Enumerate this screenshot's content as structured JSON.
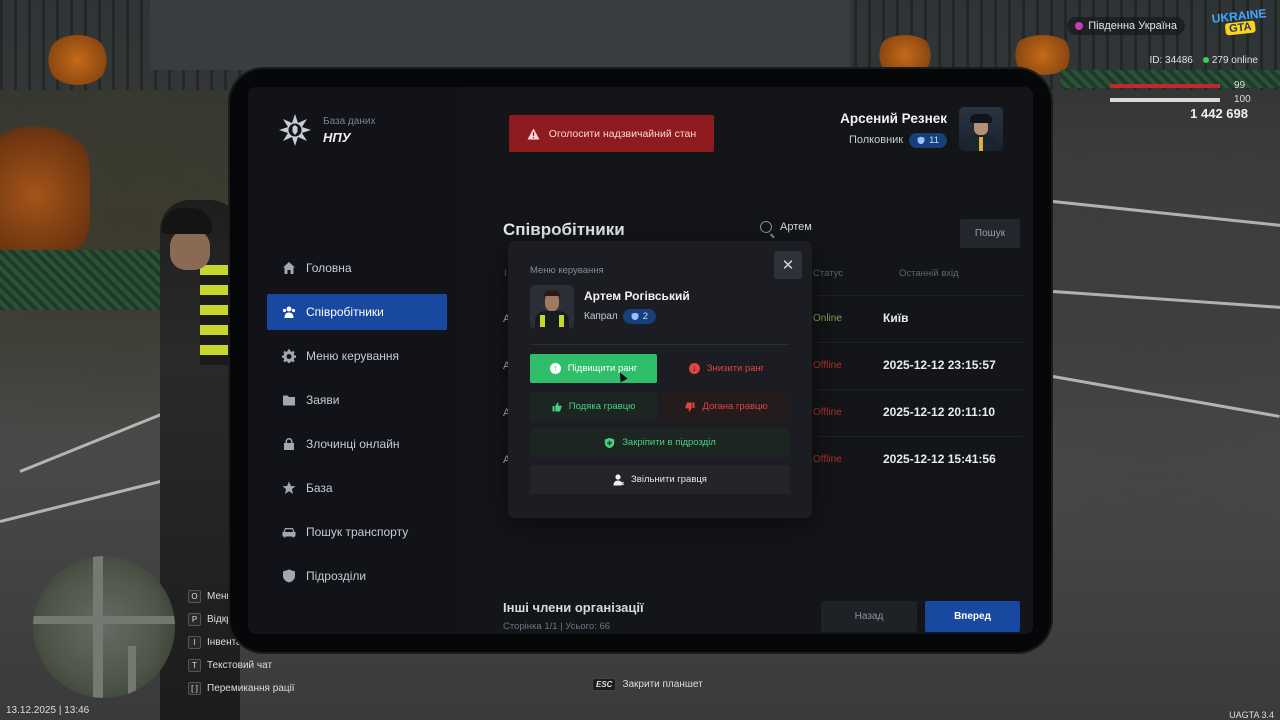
{
  "hud": {
    "region": "Південна Україна",
    "logo_line1": "UKRAINE",
    "logo_line2": "GTA",
    "id_label": "ID: 34486",
    "online_label": "279 online",
    "health": "99",
    "health_fraction": 0.99,
    "armor": "100",
    "armor_fraction": 1.0,
    "money": "1 442 698",
    "date": "13.12.2025 | 13:46",
    "version": "UAGTA 3.4",
    "hints": [
      {
        "key": "O",
        "label": "Меню"
      },
      {
        "key": "P",
        "label": "Відкрити"
      },
      {
        "key": "I",
        "label": "Інвентар"
      },
      {
        "key": "T",
        "label": "Текстовий чат"
      },
      {
        "key": "[ ]",
        "label": "Перемикання рації"
      }
    ],
    "esc_key": "ESC",
    "esc_label": "Закрити планшет"
  },
  "brand": {
    "subtitle": "База даних",
    "name": "НПУ"
  },
  "alert_button": "Оголосити надзвичайний стан",
  "profile": {
    "name": "Арсений Резнек",
    "rank": "Полковник",
    "rank_level": "11"
  },
  "nav": [
    {
      "label": "Головна",
      "icon": "home-icon"
    },
    {
      "label": "Співробітники",
      "icon": "users-icon"
    },
    {
      "label": "Меню керування",
      "icon": "gear-icon"
    },
    {
      "label": "Заяви",
      "icon": "folder-icon"
    },
    {
      "label": "Злочинці онлайн",
      "icon": "lock-icon"
    },
    {
      "label": "База",
      "icon": "star-icon"
    },
    {
      "label": "Пошук транспорту",
      "icon": "car-icon"
    },
    {
      "label": "Підрозділи",
      "icon": "shield-icon"
    }
  ],
  "page": {
    "title": "Співробітники",
    "search_value": "Артем",
    "search_button": "Пошук",
    "columns": {
      "first": "І",
      "status": "Статус",
      "last_login": "Останній вхід"
    },
    "rows": [
      {
        "first": "А",
        "status": "Online",
        "last": "Київ"
      },
      {
        "first": "А",
        "status": "Offline",
        "last": "2025-12-12 23:15:57"
      },
      {
        "first": "А",
        "status": "Offline",
        "last": "2025-12-12 20:11:10"
      },
      {
        "first": "А",
        "status": "Offline",
        "last": "2025-12-12 15:41:56"
      }
    ],
    "footer_title": "Інші члени організації",
    "footer_pages": "Сторінка 1/1 | Усього: 66",
    "back": "Назад",
    "next": "Вперед"
  },
  "modal": {
    "label": "Меню керування",
    "name": "Артем Рогівський",
    "rank": "Капрал",
    "rank_level": "2",
    "promote": "Підвищити ранг",
    "demote": "Знизити ранг",
    "thanks": "Подяка гравцю",
    "reprimand": "Догана гравцю",
    "assign": "Закріпити в підрозділ",
    "fire": "Звільнити гравця",
    "close": "✕"
  },
  "colors": {
    "accent": "#1848a0",
    "danger": "#8e1b1f",
    "success": "#2fbf6a",
    "offline": "#b3312c",
    "online": "#8aa74a"
  }
}
